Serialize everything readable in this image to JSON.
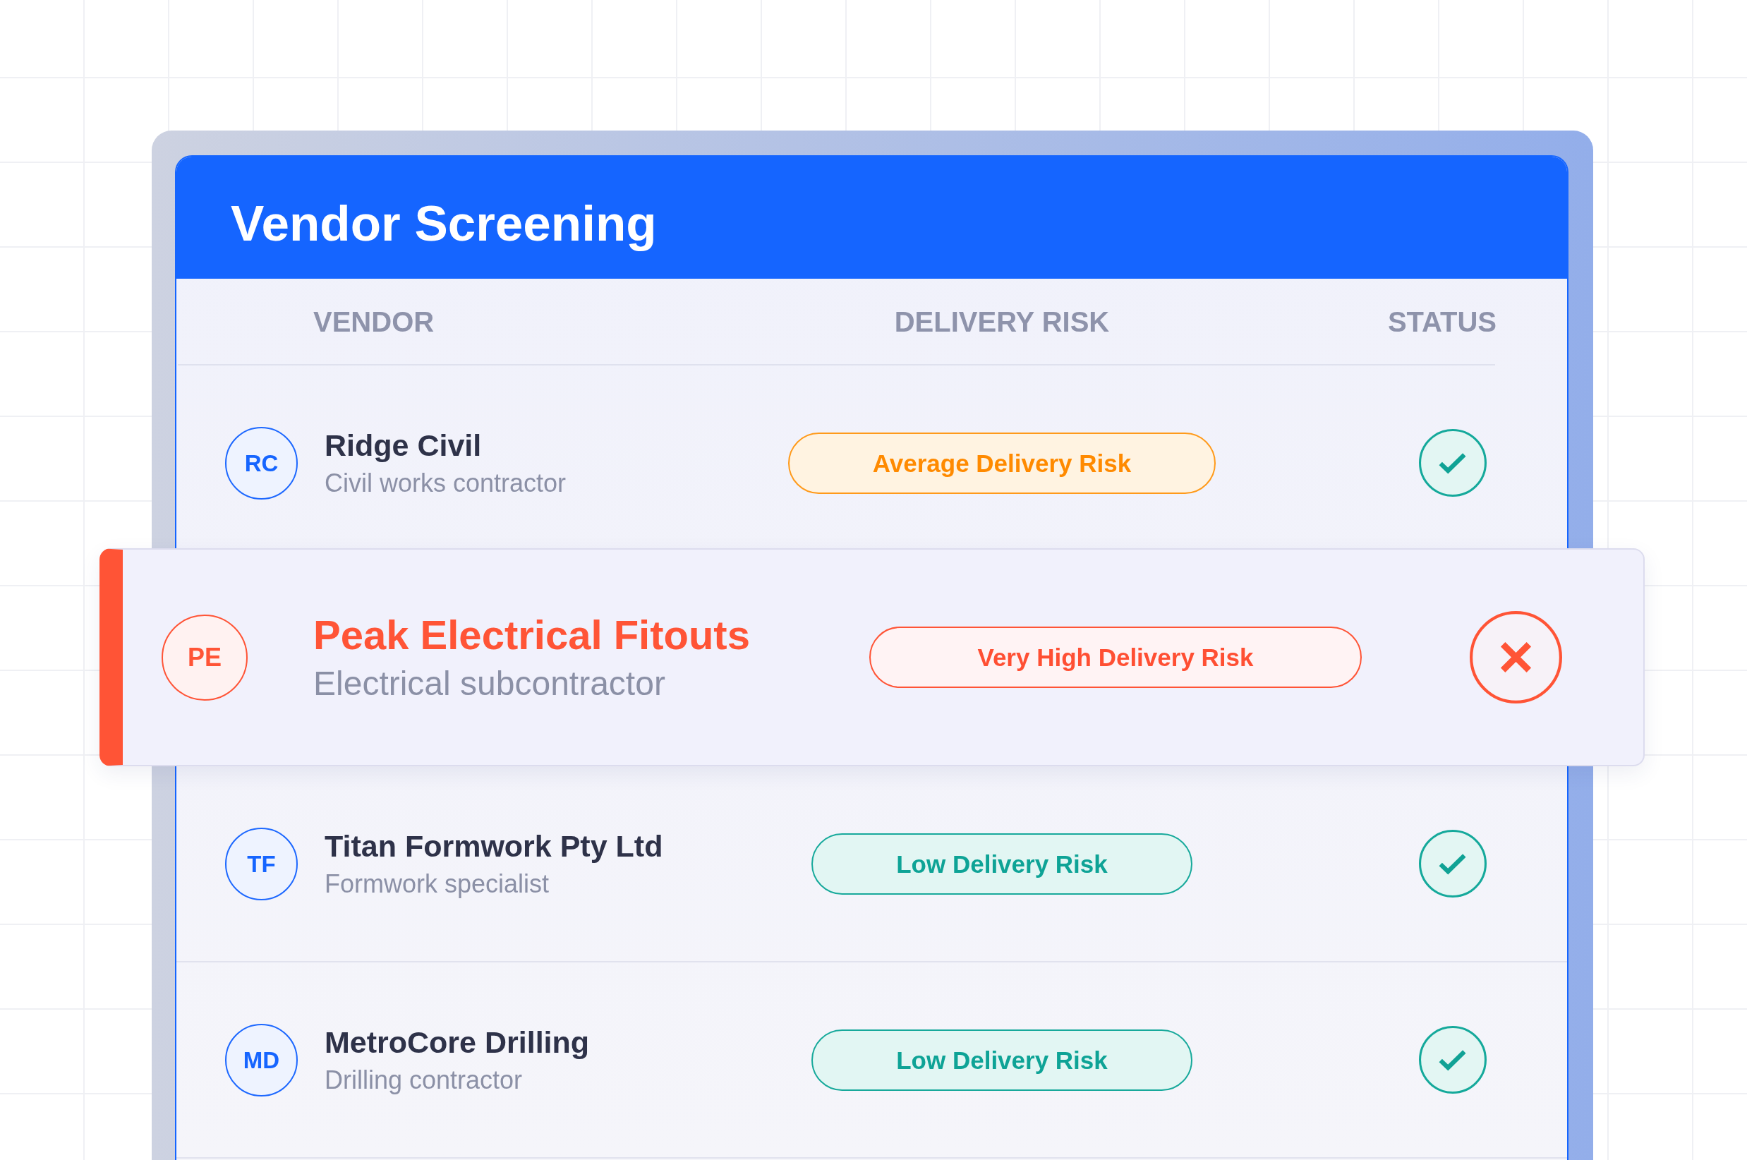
{
  "header": {
    "title": "Vendor Screening"
  },
  "table": {
    "columns": [
      "VENDOR",
      "DELIVERY RISK",
      "STATUS"
    ],
    "rows": [
      {
        "initials": "RC",
        "name": "Ridge Civil",
        "description": "Civil works contractor",
        "risk": {
          "label": "Average Delivery Risk",
          "kind": "average"
        },
        "passed": true,
        "highlighted": false
      },
      {
        "initials": "PE",
        "name": "Peak Electrical Fitouts",
        "description": "Electrical subcontractor",
        "risk": {
          "label": "Very High Delivery Risk",
          "kind": "very_high"
        },
        "passed": false,
        "highlighted": true
      },
      {
        "initials": "TF",
        "name": "Titan Formwork Pty Ltd",
        "description": "Formwork specialist",
        "risk": {
          "label": "Low Delivery Risk",
          "kind": "low"
        },
        "passed": true,
        "highlighted": false
      },
      {
        "initials": "MD",
        "name": "MetroCore Drilling",
        "description": "Drilling contractor",
        "risk": {
          "label": "Low Delivery Risk",
          "kind": "low"
        },
        "passed": true,
        "highlighted": false
      }
    ]
  }
}
